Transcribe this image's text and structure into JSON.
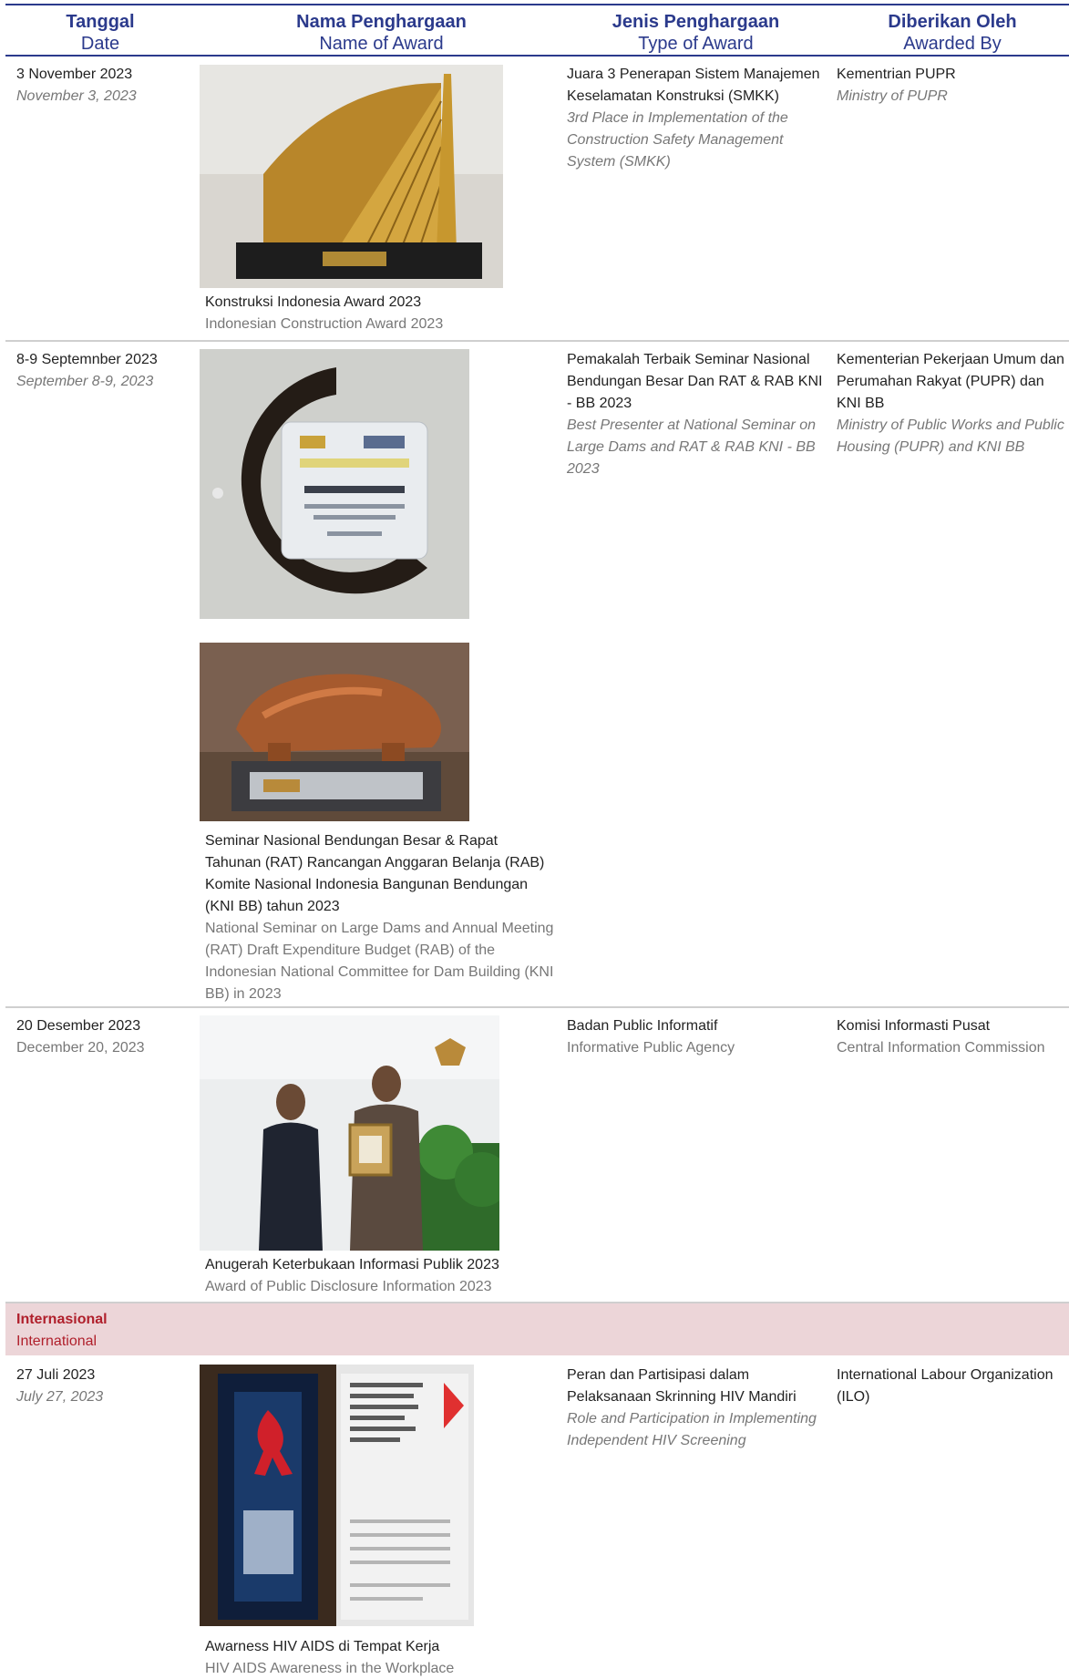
{
  "header": {
    "date_id": "Tanggal",
    "date_en": "Date",
    "name_id": "Nama Penghargaan",
    "name_en": "Name of Award",
    "type_id": "Jenis Penghargaan",
    "type_en": "Type of Award",
    "by_id": "Diberikan Oleh",
    "by_en": "Awarded By"
  },
  "rows": [
    {
      "date_id": "3 November 2023",
      "date_en": "November 3, 2023",
      "name_id": "Konstruksi Indonesia Award 2023",
      "name_en": "Indonesian Construction Award 2023",
      "type_id": "Juara 3 Penerapan Sistem Manajemen Keselamatan Konstruksi (SMKK)",
      "type_en": "3rd Place in Implementation of the Construction Safety Management System (SMKK)",
      "by_id": "Kementrian PUPR",
      "by_en": "Ministry of PUPR"
    },
    {
      "date_id": "8-9 Septemnber 2023",
      "date_en": "September 8-9, 2023",
      "name_id": "Seminar Nasional Bendungan Besar & Rapat Tahunan (RAT) Rancangan Anggaran Belanja (RAB) Komite Nasional Indonesia Bangunan Bendungan (KNI BB) tahun 2023",
      "name_en": "National Seminar on Large Dams and Annual Meeting (RAT) Draft Expenditure Budget (RAB) of the Indonesian National Committee for Dam Building (KNI BB) in 2023",
      "type_id": "Pemakalah Terbaik Seminar Nasional Bendungan Besar Dan RAT & RAB KNI - BB 2023",
      "type_en": "Best Presenter at National Seminar on Large Dams and RAT & RAB KNI - BB 2023",
      "by_id": "Kementerian Pekerjaan Umum dan Perumahan Rakyat (PUPR) dan KNI BB",
      "by_en": "Ministry of Public Works and Public Housing (PUPR) and KNI BB"
    },
    {
      "date_id": "20 Desember 2023",
      "date_en": "December 20, 2023",
      "name_id": "Anugerah Keterbukaan Informasi Publik 2023",
      "name_en": "Award of Public Disclosure Information 2023",
      "type_id": "Badan Public Informatif",
      "type_en": "Informative Public Agency",
      "by_id": "Komisi Informasti Pusat",
      "by_en": "Central Information Commission"
    },
    {
      "date_id": "27 Juli 2023",
      "date_en": "July 27, 2023",
      "name_id": "Awarness HIV AIDS di Tempat Kerja",
      "name_en": "HIV AIDS Awareness in the Workplace",
      "type_id": "Peran dan Partisipasi dalam Pelaksanaan Skrinning HIV Mandiri",
      "type_en": "Role and Participation in Implementing Independent HIV Screening",
      "by_id": "International Labour Organization (ILO)",
      "by_en": ""
    }
  ],
  "section": {
    "title_id": "Internasional",
    "title_en": "International"
  },
  "colors": {
    "header": "#2b3a8c",
    "band": "#ecd5d8",
    "band_text": "#b0202c"
  }
}
